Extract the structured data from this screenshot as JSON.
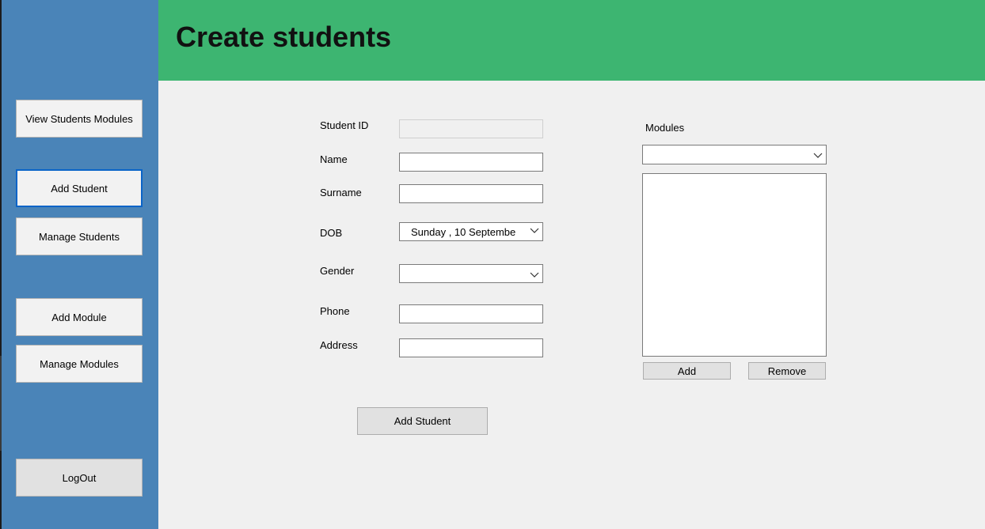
{
  "header": {
    "title": "Create students"
  },
  "sidebar": {
    "items": [
      {
        "label": "View Students  Modules"
      },
      {
        "label": "Add Student"
      },
      {
        "label": "Manage Students"
      },
      {
        "label": "Add Module"
      },
      {
        "label": "Manage Modules"
      },
      {
        "label": "LogOut"
      }
    ]
  },
  "form": {
    "student_id_label": "Student ID",
    "name_label": "Name",
    "surname_label": "Surname",
    "dob_label": "DOB",
    "dob_value": "Sunday    , 10 Septembe",
    "gender_label": "Gender",
    "phone_label": "Phone",
    "address_label": "Address",
    "submit_label": "Add Student"
  },
  "modules": {
    "label": "Modules",
    "add_label": "Add",
    "remove_label": "Remove"
  },
  "colors": {
    "sidebar": "#4a84b8",
    "header": "#3db571",
    "background": "#f0f0f0"
  }
}
